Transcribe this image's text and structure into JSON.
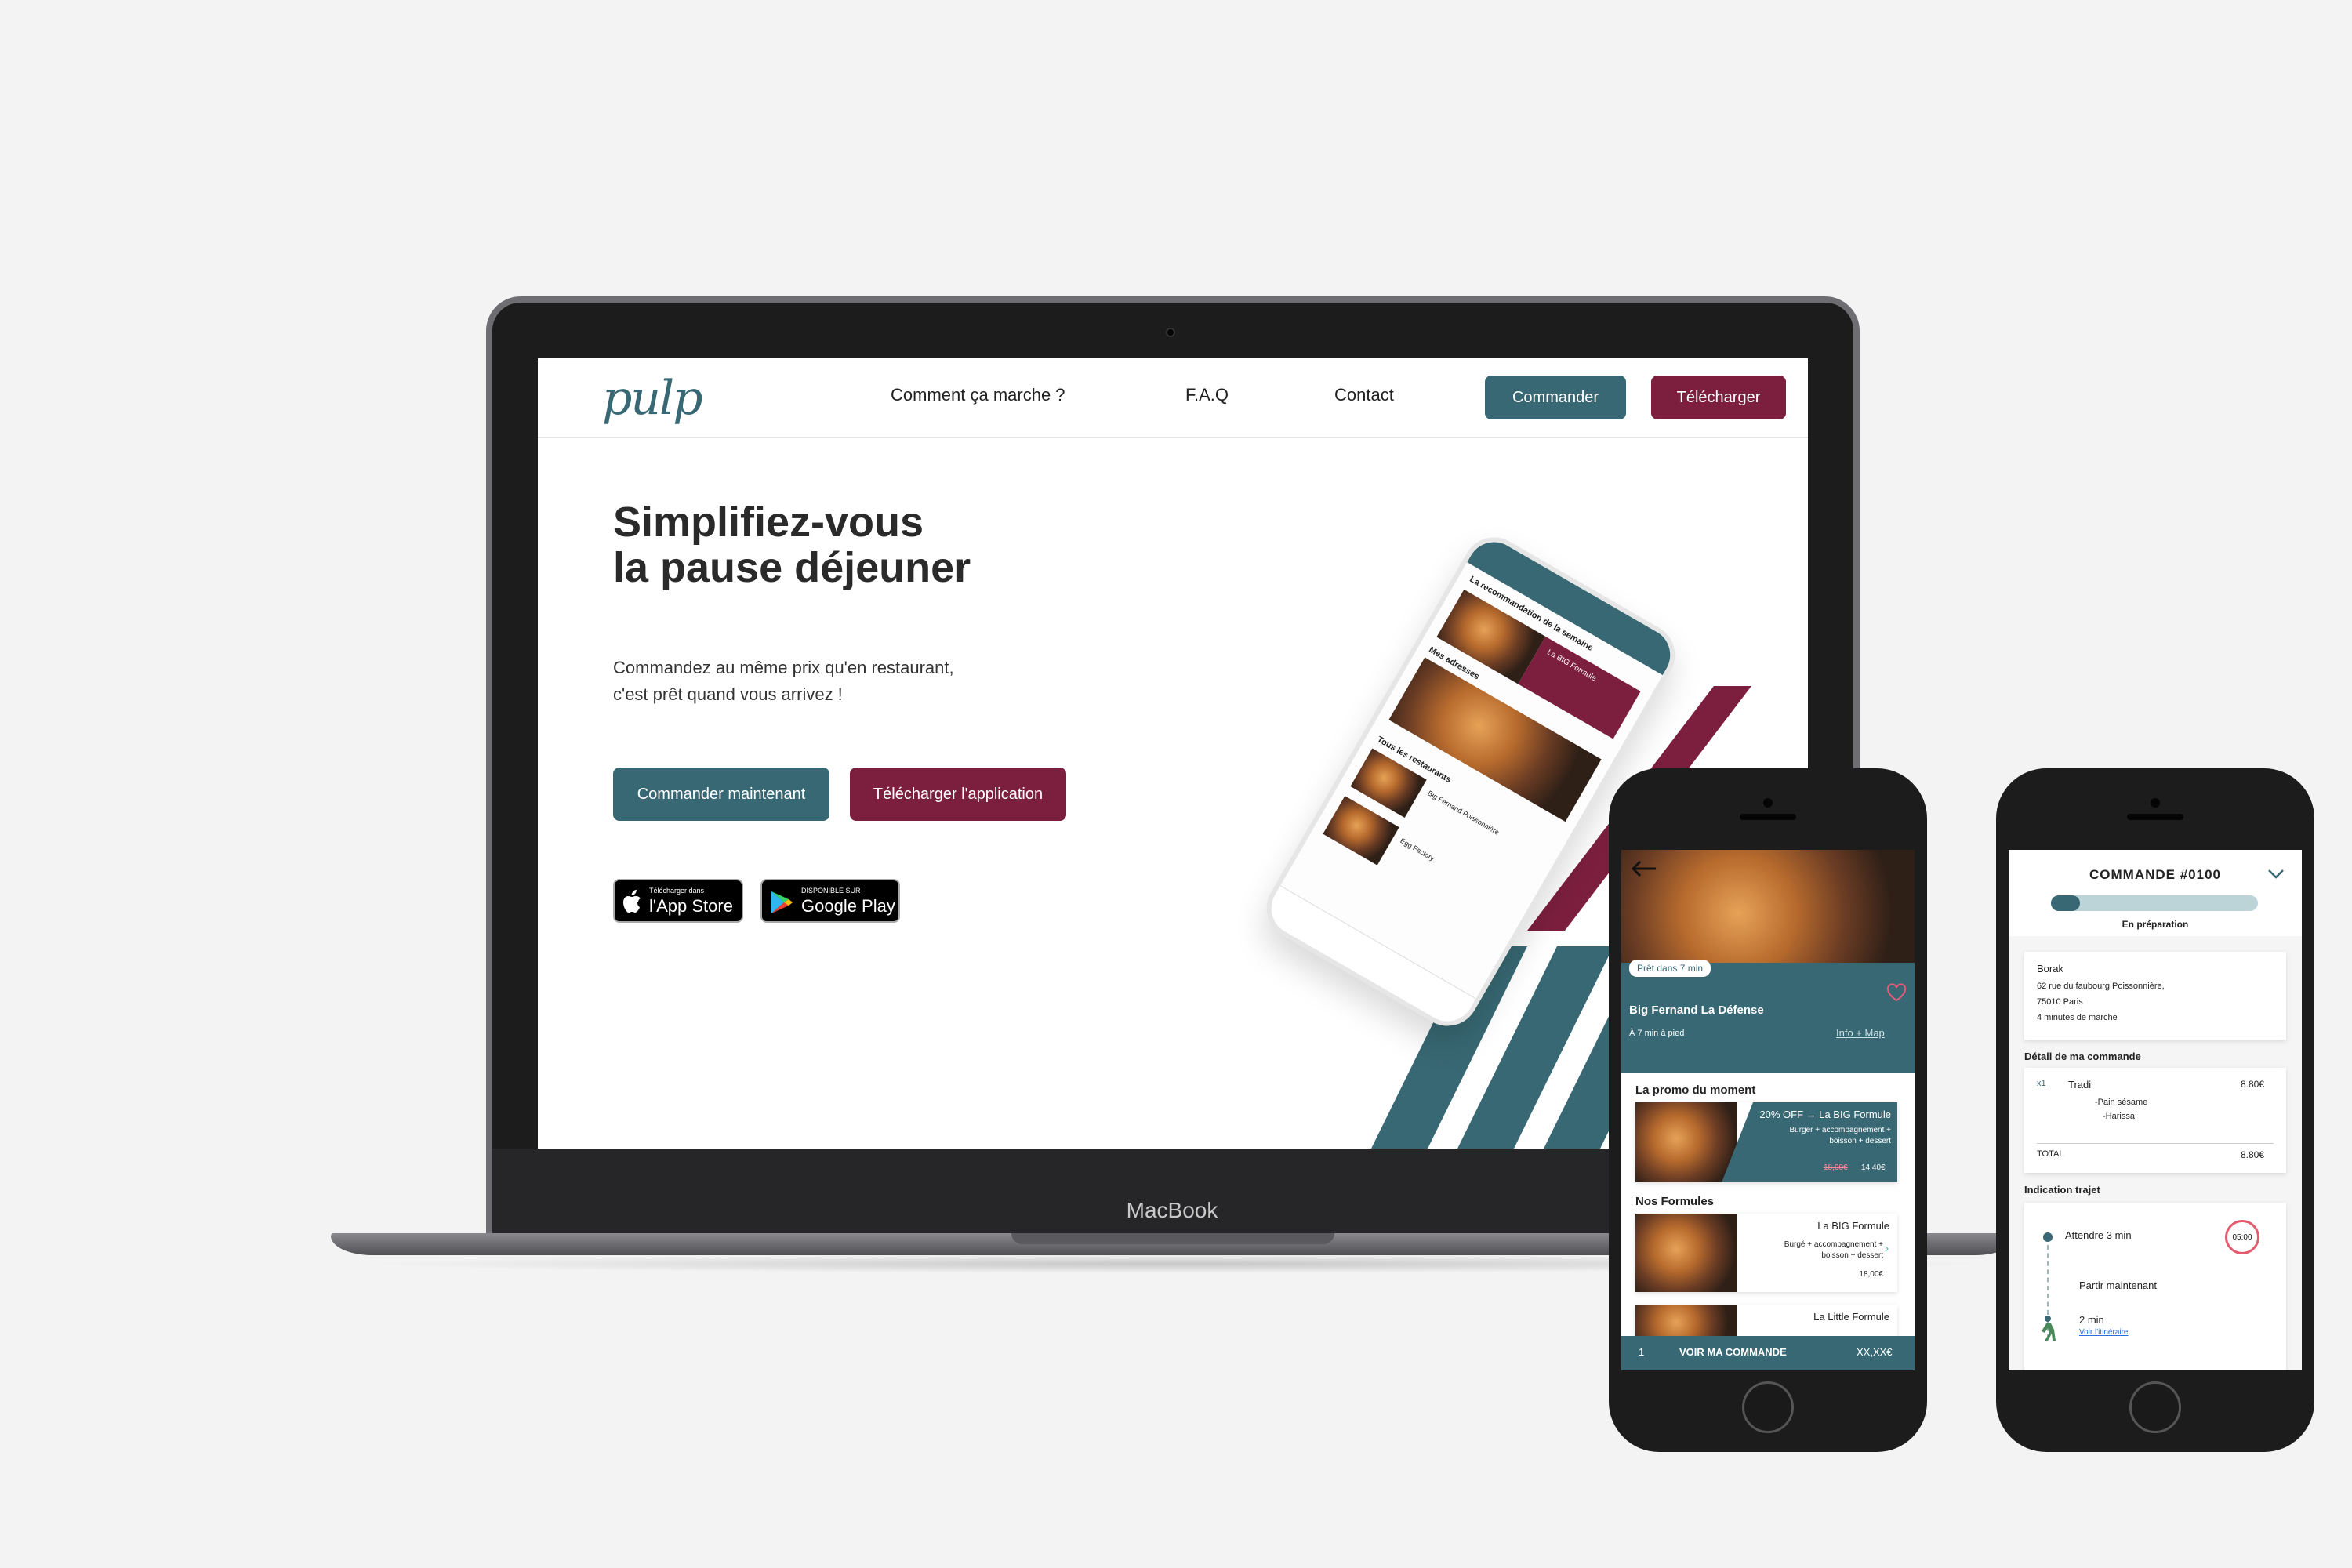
{
  "website": {
    "logo": "pulp",
    "nav": {
      "links": [
        "Comment ça marche ?",
        "F.A.Q",
        "Contact"
      ],
      "order_button": "Commander",
      "download_button": "Télécharger"
    },
    "hero": {
      "title_line1": "Simplifiez-vous",
      "title_line2": "la pause déjeuner",
      "subtitle_line1": "Commandez au même prix qu'en restaurant,",
      "subtitle_line2": "c'est prêt quand vous arrivez !",
      "cta_order": "Commander maintenant",
      "cta_download": "Télécharger l'application"
    },
    "stores": {
      "apple_small": "Télécharger dans",
      "apple_big": "l'App Store",
      "google_small": "DISPONIBLE SUR",
      "google_big": "Google Play"
    },
    "tilted_phone": {
      "header": "La recommandation de la semaine",
      "section1": "Mes adresses",
      "section2": "Tous les restaurants",
      "promo": "La BIG Formule",
      "restaurant1": "Big Fernand Poissonnière",
      "restaurant2": "Egg Factory"
    }
  },
  "laptop": {
    "brand": "MacBook"
  },
  "phone_restaurant": {
    "ready_badge": "Prêt dans 7 min",
    "restaurant_name": "Big Fernand La Défense",
    "distance": "À 7 min à pied",
    "info_link": "Info + Map",
    "promo_heading": "La promo du moment",
    "promo_title": "20% OFF → La BIG Formule",
    "promo_desc_line1": "Burger + accompagnement +",
    "promo_desc_line2": "boisson + dessert",
    "promo_price_old": "18,00€",
    "promo_price_new": "14,40€",
    "formules_heading": "Nos Formules",
    "formule1_title": "La BIG Formule",
    "formule1_desc_line1": "Burgé + accompagnement +",
    "formule1_desc_line2": "boisson + dessert",
    "formule1_price": "18,00€",
    "formule2_title": "La Little Formule",
    "bar_count": "1",
    "bar_label": "VOIR MA COMMANDE",
    "bar_total": "XX,XX€"
  },
  "phone_order": {
    "title": "COMMANDE #0100",
    "progress": 0.14,
    "status": "En préparation",
    "restaurant": "Borak",
    "address_line1": "62 rue du faubourg Poissonnière,",
    "address_line2": "75010 Paris",
    "walk": "4 minutes de marche",
    "detail_heading": "Détail de ma commande",
    "item_qty": "x1",
    "item_name": "Tradi",
    "item_price": "8.80€",
    "item_opt1": "-Pain sésame",
    "item_opt2": "-Harissa",
    "total_label": "TOTAL",
    "total_value": "8.80€",
    "route_heading": "Indication trajet",
    "step1": "Attendre 3 min",
    "timer": "05:00",
    "step2": "Partir maintenant",
    "step3": "2 min",
    "itinerary_link": "Voir l'itinéraire"
  },
  "colors": {
    "teal": "#386873",
    "wine": "#7c1f3f",
    "background": "#f3f3f3"
  }
}
